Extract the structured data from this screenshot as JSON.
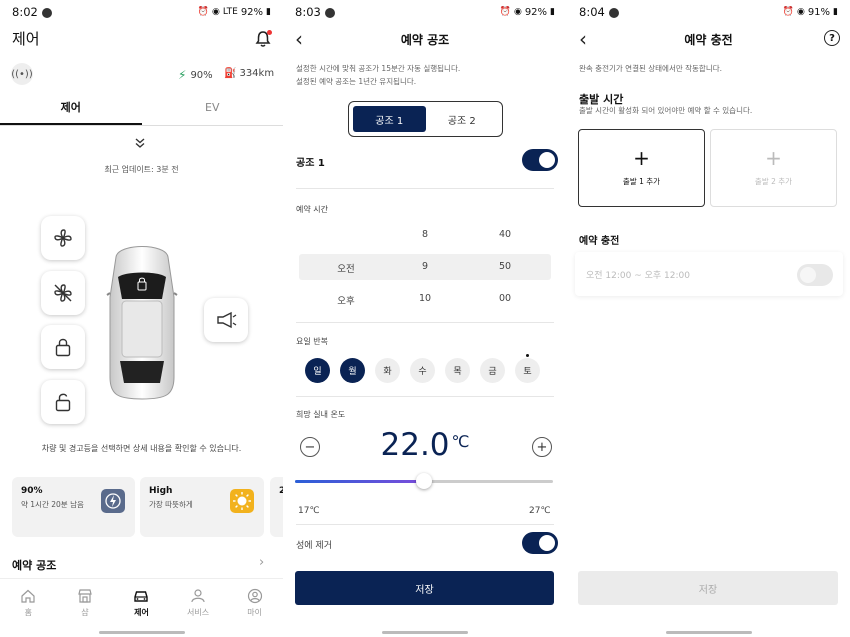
{
  "screen1": {
    "status": {
      "time": "8:02",
      "battery": "92%",
      "network": "LTE"
    },
    "title": "제어",
    "battery_percent": "90%",
    "range": "334km",
    "tabs": [
      {
        "label": "제어",
        "active": true
      },
      {
        "label": "EV",
        "active": false
      }
    ],
    "updated": "최근 업데이트: 3분 전",
    "hint": "차량 및 경고등을 선택하면 상세 내용을 확인할 수 있습니다.",
    "cards": [
      {
        "title": "90%",
        "sub": "약 1시간 20분 남음",
        "icon": "battery-charge-icon",
        "color": "#5a6b8c"
      },
      {
        "title": "High",
        "sub": "가장 따뜻하게",
        "icon": "sun-icon",
        "color": "#f2b21d"
      },
      {
        "title": "2"
      }
    ],
    "reservation_label": "예약 공조",
    "bottom_nav": [
      "홈",
      "샵",
      "제어",
      "서비스",
      "마이"
    ],
    "bottom_nav_active": "제어"
  },
  "screen2": {
    "status": {
      "time": "8:03",
      "battery": "92%"
    },
    "title": "예약 공조",
    "desc1": "설정한 시간에 맞춰 공조가 15분간 자동 실행됩니다.",
    "desc2": "설정된 예약 공조는 1년간 유지됩니다.",
    "segments": [
      {
        "label": "공조 1",
        "active": true
      },
      {
        "label": "공조 2",
        "active": false
      }
    ],
    "ac_label": "공조 1",
    "ac_enabled": true,
    "time_label": "예약 시간",
    "picker": {
      "ampm": [
        "",
        "오전",
        "오후"
      ],
      "hours": [
        "8",
        "9",
        "10"
      ],
      "minutes": [
        "40",
        "50",
        "00"
      ],
      "selected": {
        "ampm": "오전",
        "hour": "9",
        "minute": "50"
      }
    },
    "repeat_label": "요일 반복",
    "days": [
      {
        "label": "일",
        "selected": true
      },
      {
        "label": "월",
        "selected": true
      },
      {
        "label": "화",
        "selected": false
      },
      {
        "label": "수",
        "selected": false
      },
      {
        "label": "목",
        "selected": false
      },
      {
        "label": "금",
        "selected": false
      },
      {
        "label": "토",
        "selected": false
      }
    ],
    "temp_label": "희망 실내 온도",
    "temperature": "22.0",
    "temp_unit": "℃",
    "temp_min": "17℃",
    "temp_max": "27℃",
    "temp_fraction": 0.5,
    "defrost_label": "성에 제거",
    "defrost_enabled": true,
    "save": "저장",
    "accent": "#0a2354"
  },
  "screen3": {
    "status": {
      "time": "8:04",
      "battery": "91%"
    },
    "title": "예약 충전",
    "desc": "완속 충전기가 연결된 상태에서만 작동합니다.",
    "departure_title": "출발 시간",
    "departure_desc": "출발 시간이 활성화 되어 있어야만 예약 할 수 있습니다.",
    "add1": "출발 1 추가",
    "add2": "출발 2 추가",
    "charge_title": "예약 충전",
    "charge_time": "오전 12:00 ~ 오후 12:00",
    "charge_enabled": false,
    "save": "저장"
  }
}
